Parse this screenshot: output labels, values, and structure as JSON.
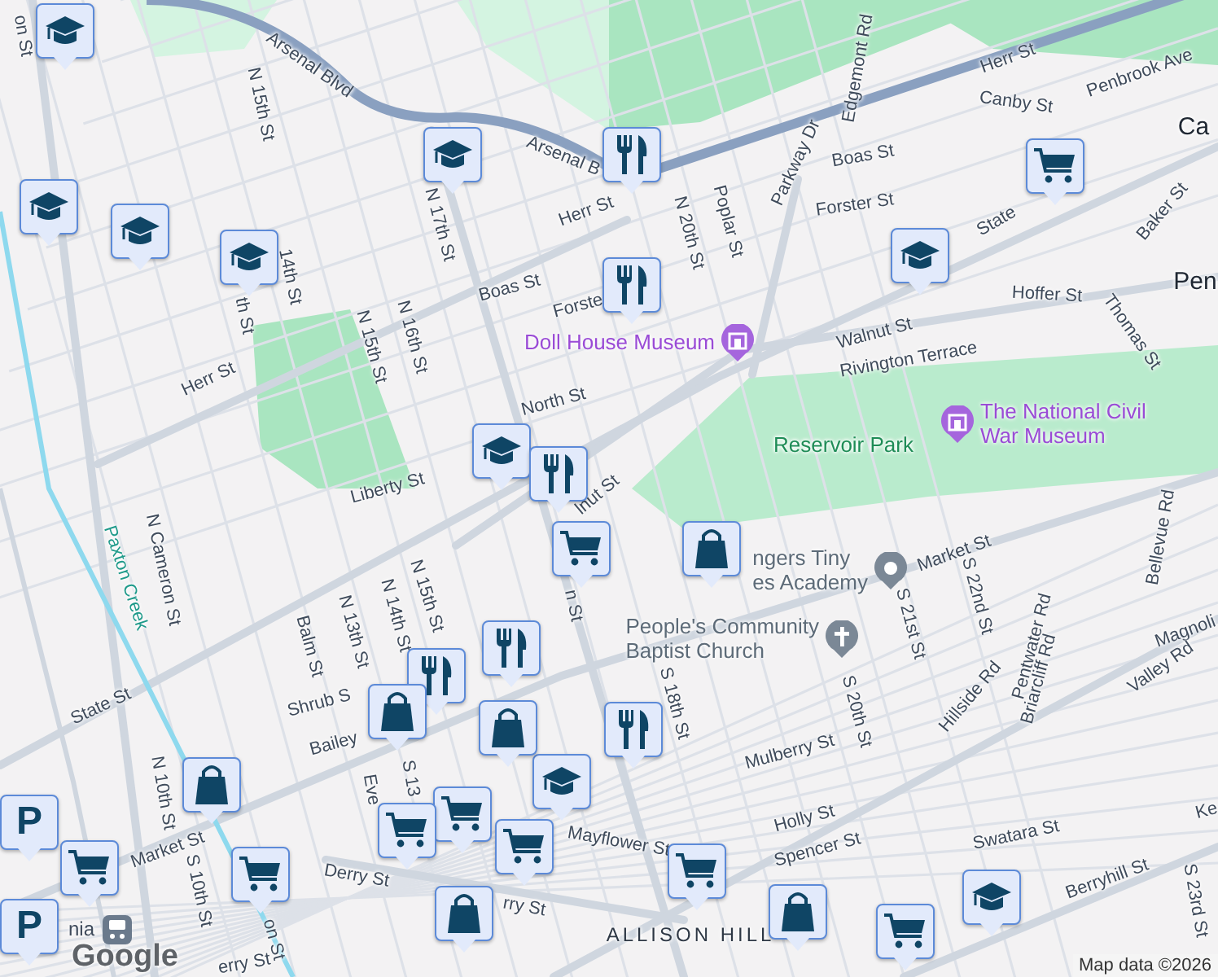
{
  "map": {
    "labels": [
      {
        "text": "on St",
        "kind": "street"
      },
      {
        "text": "Arsenal Blvd",
        "kind": "street"
      },
      {
        "text": "N 15th St",
        "kind": "street"
      },
      {
        "text": "Arsenal B",
        "kind": "street"
      },
      {
        "text": "N 17th St",
        "kind": "street"
      },
      {
        "text": "Herr St",
        "kind": "street"
      },
      {
        "text": "14th St",
        "kind": "street"
      },
      {
        "text": "th St",
        "kind": "street"
      },
      {
        "text": "Boas St",
        "kind": "street"
      },
      {
        "text": "Forste",
        "kind": "street"
      },
      {
        "text": "N 16th St",
        "kind": "street"
      },
      {
        "text": "N 15th St",
        "kind": "street"
      },
      {
        "text": "Herr St",
        "kind": "street"
      },
      {
        "text": "N 20th St",
        "kind": "street"
      },
      {
        "text": "Poplar St",
        "kind": "street"
      },
      {
        "text": "Parkway Dr",
        "kind": "street"
      },
      {
        "text": "Edgemont Rd",
        "kind": "street"
      },
      {
        "text": "Herr St",
        "kind": "street"
      },
      {
        "text": "Canby St",
        "kind": "street"
      },
      {
        "text": "Penbrook Ave",
        "kind": "street"
      },
      {
        "text": "Ca",
        "kind": "town"
      },
      {
        "text": "Boas St",
        "kind": "street"
      },
      {
        "text": "Forster St",
        "kind": "street"
      },
      {
        "text": "State",
        "kind": "street"
      },
      {
        "text": "Baker St",
        "kind": "street"
      },
      {
        "text": "Pen",
        "kind": "town"
      },
      {
        "text": "Hoffer St",
        "kind": "street"
      },
      {
        "text": "Thomas St",
        "kind": "street"
      },
      {
        "text": "Walnut St",
        "kind": "street"
      },
      {
        "text": "Rivington Terrace",
        "kind": "street"
      },
      {
        "text": "North St",
        "kind": "street"
      },
      {
        "text": "Liberty St",
        "kind": "street"
      },
      {
        "text": "lnut St",
        "kind": "street"
      },
      {
        "text": "Paxton Creek",
        "kind": "water"
      },
      {
        "text": "N Cameron St",
        "kind": "street"
      },
      {
        "text": "Balm St",
        "kind": "street"
      },
      {
        "text": "N 13th St",
        "kind": "street"
      },
      {
        "text": "N 14th St",
        "kind": "street"
      },
      {
        "text": "N 15th St",
        "kind": "street"
      },
      {
        "text": "n St",
        "kind": "street"
      },
      {
        "text": "State St",
        "kind": "street"
      },
      {
        "text": "Shrub S",
        "kind": "street"
      },
      {
        "text": "Bailey",
        "kind": "street"
      },
      {
        "text": "N 10th St",
        "kind": "street"
      },
      {
        "text": "Market St",
        "kind": "street"
      },
      {
        "text": "S 10th St",
        "kind": "street"
      },
      {
        "text": "Eve",
        "kind": "street"
      },
      {
        "text": "S 13",
        "kind": "street"
      },
      {
        "text": "Derry St",
        "kind": "street"
      },
      {
        "text": "Mayflower St",
        "kind": "street"
      },
      {
        "text": "rry St",
        "kind": "street"
      },
      {
        "text": "erry St",
        "kind": "street"
      },
      {
        "text": "on St",
        "kind": "street"
      },
      {
        "text": "S 18th St",
        "kind": "street"
      },
      {
        "text": "Market St",
        "kind": "street"
      },
      {
        "text": "S 21st St",
        "kind": "street"
      },
      {
        "text": "S 22nd St",
        "kind": "street"
      },
      {
        "text": "S 20th St",
        "kind": "street"
      },
      {
        "text": "Hillside Rd",
        "kind": "street"
      },
      {
        "text": "Pentwater Rd",
        "kind": "street"
      },
      {
        "text": "Briarcliff Rd",
        "kind": "street"
      },
      {
        "text": "Bellevue Rd",
        "kind": "street"
      },
      {
        "text": "Magnoli",
        "kind": "street"
      },
      {
        "text": "Valley Rd",
        "kind": "street"
      },
      {
        "text": "Mulberry St",
        "kind": "street"
      },
      {
        "text": "Holly St",
        "kind": "street"
      },
      {
        "text": "Spencer St",
        "kind": "street"
      },
      {
        "text": "Swatara St",
        "kind": "street"
      },
      {
        "text": "Berryhill St",
        "kind": "street"
      },
      {
        "text": "Ke",
        "kind": "street"
      },
      {
        "text": "S 23rd St",
        "kind": "street"
      },
      {
        "text": "ALLISON HILL",
        "kind": "district"
      },
      {
        "text": "Reservoir Park",
        "kind": "park"
      }
    ],
    "places": [
      {
        "lines": [
          "Doll House Museum"
        ],
        "kind": "museum"
      },
      {
        "lines": [
          "The National Civil",
          "War Museum"
        ],
        "kind": "museum"
      },
      {
        "lines": [
          "ngers Tiny",
          "es Academy"
        ],
        "kind": "place"
      },
      {
        "lines": [
          "People's Community",
          "Baptist Church"
        ],
        "kind": "church"
      },
      {
        "lines": [
          "nia"
        ],
        "kind": "train"
      }
    ],
    "markers": [
      {
        "kind": "school"
      },
      {
        "kind": "school"
      },
      {
        "kind": "school"
      },
      {
        "kind": "school"
      },
      {
        "kind": "school"
      },
      {
        "kind": "school"
      },
      {
        "kind": "school"
      },
      {
        "kind": "school"
      },
      {
        "kind": "school"
      },
      {
        "kind": "restaurant"
      },
      {
        "kind": "restaurant"
      },
      {
        "kind": "restaurant"
      },
      {
        "kind": "restaurant"
      },
      {
        "kind": "restaurant"
      },
      {
        "kind": "restaurant"
      },
      {
        "kind": "cart"
      },
      {
        "kind": "cart"
      },
      {
        "kind": "cart"
      },
      {
        "kind": "cart"
      },
      {
        "kind": "cart"
      },
      {
        "kind": "cart"
      },
      {
        "kind": "cart"
      },
      {
        "kind": "cart"
      },
      {
        "kind": "cart"
      },
      {
        "kind": "shopping"
      },
      {
        "kind": "shopping"
      },
      {
        "kind": "shopping"
      },
      {
        "kind": "shopping"
      },
      {
        "kind": "shopping"
      },
      {
        "kind": "shopping"
      },
      {
        "kind": "parking",
        "glyph": "P"
      },
      {
        "kind": "parking",
        "glyph": "P"
      }
    ],
    "logo": "Google",
    "attribution": "Map data ©2026"
  }
}
